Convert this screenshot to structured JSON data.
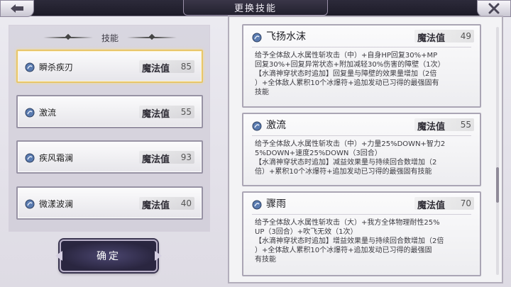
{
  "header": {
    "title": "更换技能",
    "back_icon": "arrow-left-icon",
    "close_icon": "close-icon"
  },
  "left_panel": {
    "title": "技能",
    "skills": [
      {
        "name": "瞬杀疾刃",
        "mp_label": "魔法值",
        "mp": "85",
        "selected": true,
        "icon": "water-drop-icon"
      },
      {
        "name": "激流",
        "mp_label": "魔法值",
        "mp": "55",
        "selected": false,
        "icon": "water-drop-icon"
      },
      {
        "name": "疾风霜澜",
        "mp_label": "魔法值",
        "mp": "93",
        "selected": false,
        "icon": "water-drop-icon"
      },
      {
        "name": "微漾波澜",
        "mp_label": "魔法值",
        "mp": "40",
        "selected": false,
        "icon": "water-drop-icon"
      }
    ],
    "confirm_label": "确定"
  },
  "right_panel": {
    "skills": [
      {
        "name": "飞扬水沫",
        "mp_label": "魔法值",
        "mp": "49",
        "lines": [
          "给予全体敌人水属性斩攻击（中）+自身HP回复30%+MP",
          "回复30%+回复异常状态+附加减轻30%伤害的障壁（1次）",
          "【水滴神穿状态时追加】回复量与障壁的效果量增加（2倍",
          "）+全体敌人累积10个冰爆符+追加发动已习得的最强固有",
          "技能"
        ]
      },
      {
        "name": "激流",
        "mp_label": "魔法值",
        "mp": "55",
        "lines": [
          "给予全体敌人水属性斩攻击（中）+力量25%DOWN+智力2",
          "5%DOWN+速度25%DOWN（3回合）",
          "【水滴神穿状态时追加】减益效果量与持续回合数增加（2",
          "倍）+累积10个冰爆符+追加发动已习得的最强固有技能"
        ]
      },
      {
        "name": "骤雨",
        "mp_label": "魔法值",
        "mp": "70",
        "lines": [
          "给予全体敌人水属性斩攻击（大）+我方全体物理耐性25%",
          "UP（3回合）+吹飞无效（1次）",
          "【水滴神穿状态时追加】增益效果量与持续回合数增加（2倍",
          "）+全体敌人累积10个冰爆符+追加发动已习得的最强固",
          "有技能"
        ]
      }
    ]
  },
  "colors": {
    "selected_border": "#e8c66a",
    "card_border": "#9792a4",
    "icon_blue": "#4a6fa5"
  }
}
